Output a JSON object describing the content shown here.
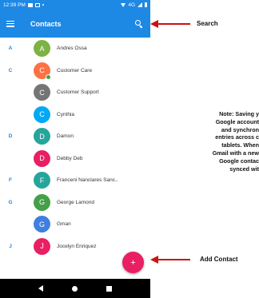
{
  "status_bar": {
    "time": "12:39 PM",
    "network": "4G"
  },
  "app_bar": {
    "title": "Contacts"
  },
  "contacts": [
    {
      "section": "A",
      "initial": "A",
      "name": "Andres Ossa",
      "color": "#7cb342"
    },
    {
      "section": "C",
      "initial": "C",
      "name": "Customer Care",
      "color": "#ff7043"
    },
    {
      "section": "",
      "initial": "C",
      "name": "Customer Support",
      "color": "#757575"
    },
    {
      "section": "",
      "initial": "C",
      "name": "Cynthia",
      "color": "#03a9f4"
    },
    {
      "section": "D",
      "initial": "D",
      "name": "Damon",
      "color": "#26a69a"
    },
    {
      "section": "",
      "initial": "D",
      "name": "Debby Deb",
      "color": "#e91e63"
    },
    {
      "section": "F",
      "initial": "F",
      "name": "Franceni Nanclares Sanc..",
      "color": "#26a69a"
    },
    {
      "section": "G",
      "initial": "G",
      "name": "George Lamond",
      "color": "#43a047"
    },
    {
      "section": "",
      "initial": "G",
      "name": "Gman",
      "color": "#3f7fe0"
    },
    {
      "section": "J",
      "initial": "J",
      "name": "Jocelyn Enriquez",
      "color": "#e91e63"
    }
  ],
  "fab": {
    "label": "+"
  },
  "annotations": {
    "search_label": "Search",
    "add_contact_label": "Add Contact",
    "note_lines": [
      "Note: Saving y",
      "Google account",
      "and synchron",
      "entries across c",
      "tablets. When",
      "Gmail with a new",
      "Google contac",
      "synced wit"
    ],
    "arrow_color": "#cc1111"
  },
  "colors": {
    "primary": "#1e88e5",
    "accent": "#e91e63"
  }
}
